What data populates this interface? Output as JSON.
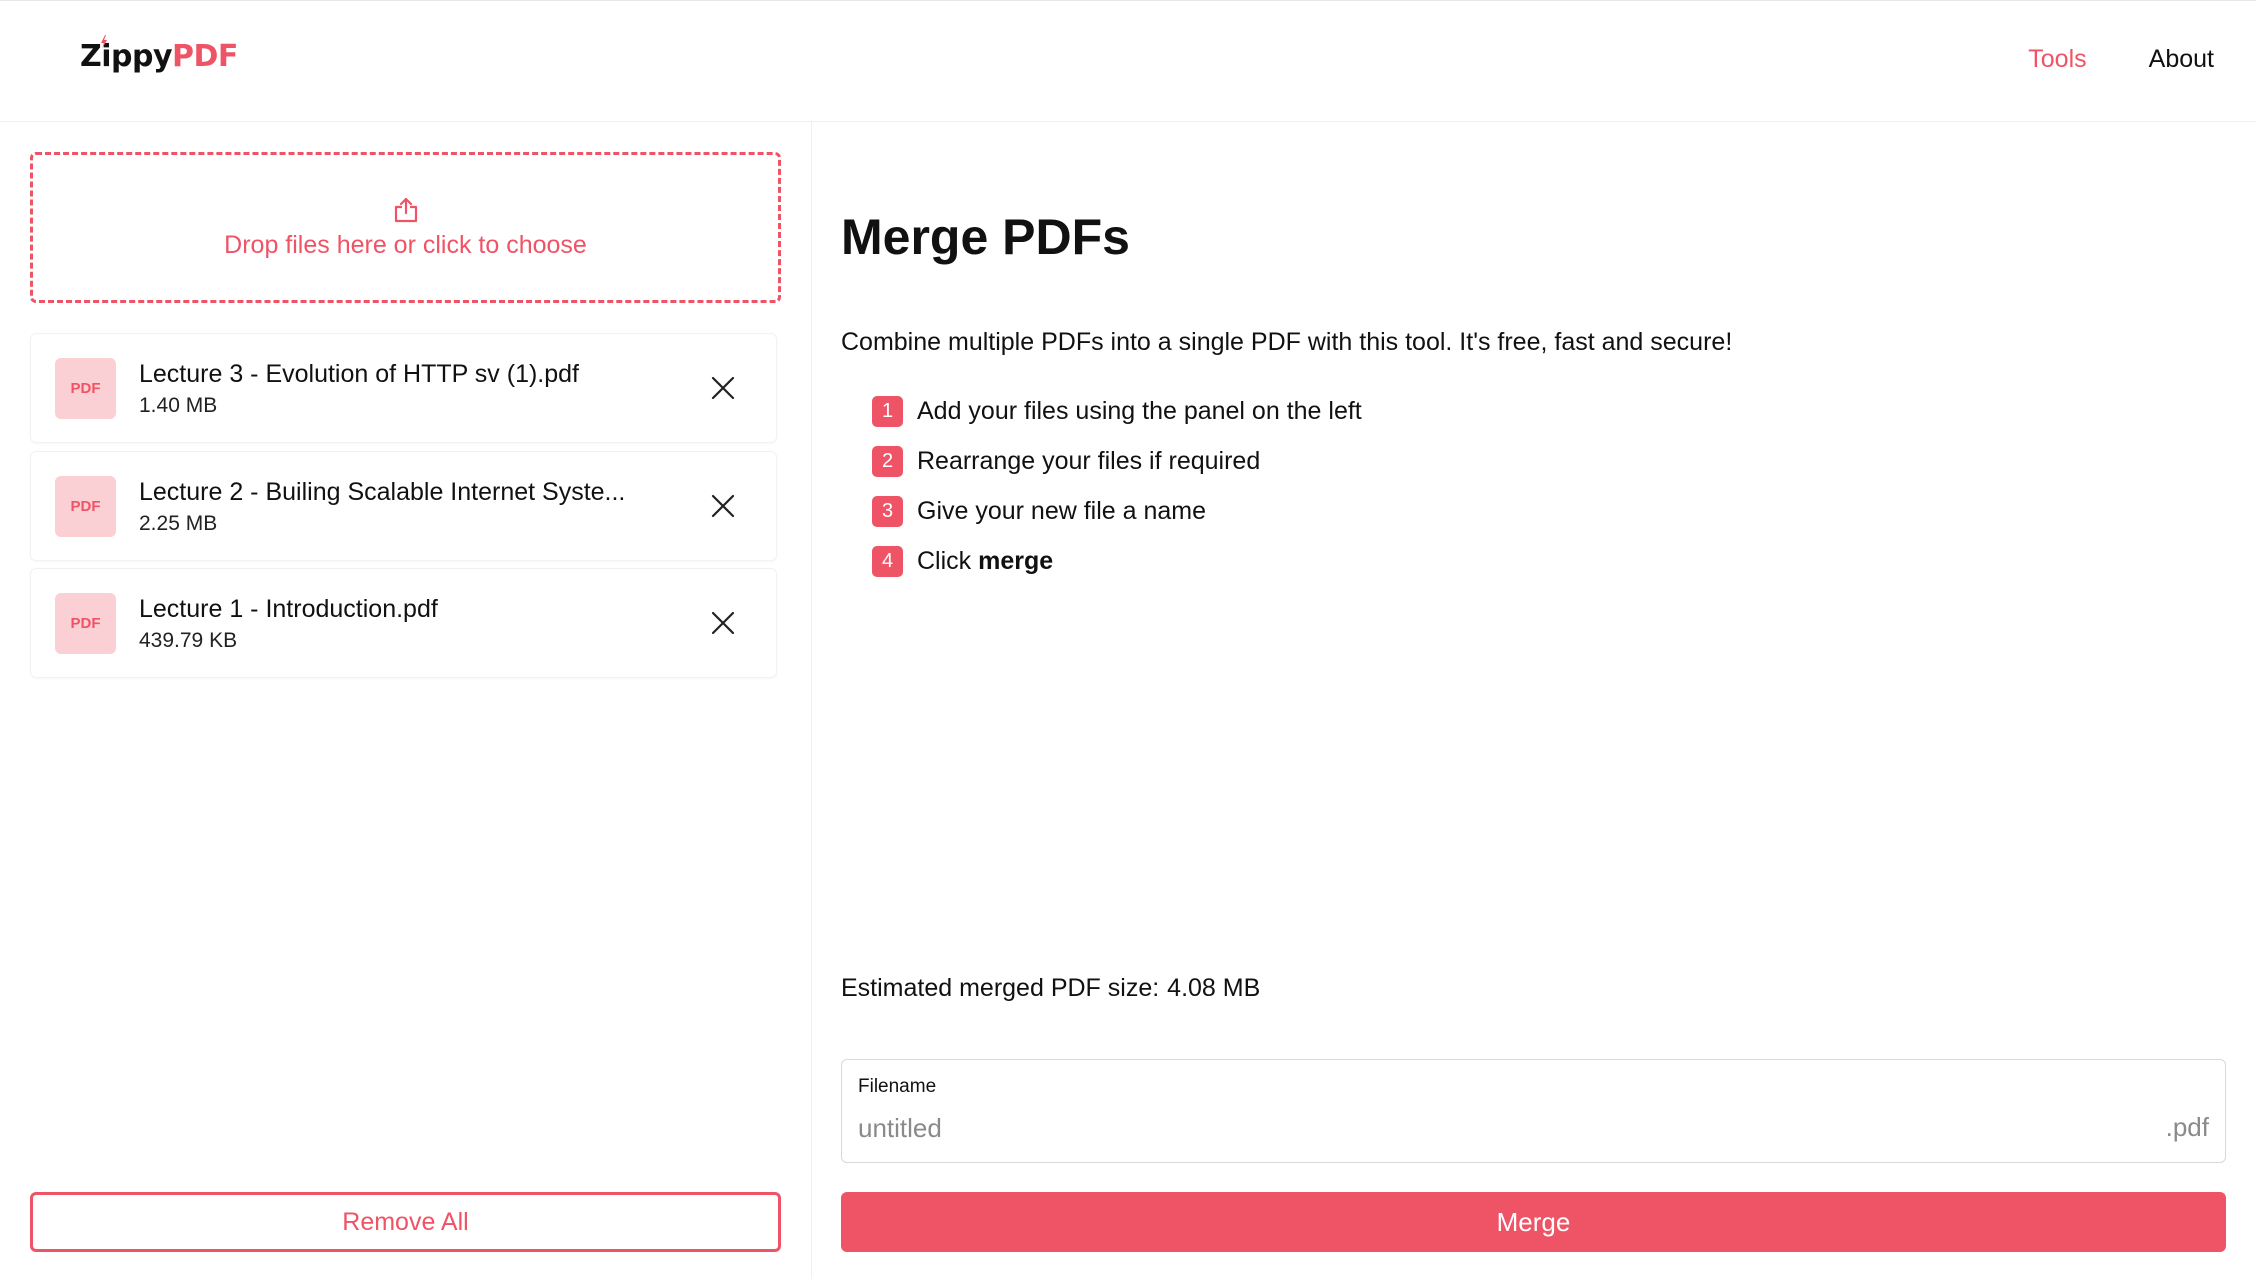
{
  "header": {
    "logo_main": "Zippy",
    "logo_accent": "PDF",
    "nav": [
      {
        "label": "Tools"
      },
      {
        "label": "About"
      }
    ]
  },
  "upload": {
    "icon": "upload-icon",
    "text": "Drop files here or click to choose"
  },
  "files": [
    {
      "badge": "PDF",
      "name": "Lecture 3 - Evolution of HTTP sv (1).pdf",
      "size": "1.40 MB"
    },
    {
      "badge": "PDF",
      "name": "Lecture 2 - Builing Scalable Internet Syste...",
      "size": "2.25 MB"
    },
    {
      "badge": "PDF",
      "name": "Lecture 1 - Introduction.pdf",
      "size": "439.79 KB"
    }
  ],
  "remove_all_label": "Remove All",
  "main": {
    "title": "Merge PDFs",
    "description": "Combine multiple PDFs into a single PDF with this tool. It's free, fast and secure!",
    "steps": [
      {
        "num": "1",
        "text": "Add your files using the panel on the left"
      },
      {
        "num": "2",
        "text": "Rearrange your files if required"
      },
      {
        "num": "3",
        "text": "Give your new file a name"
      },
      {
        "num": "4",
        "text": "Click",
        "bold": "merge"
      }
    ],
    "estimate_label": "Estimated merged PDF size:",
    "estimate_value": "4.08 MB",
    "filename_label": "Filename",
    "filename_placeholder": "untitled",
    "filename_value": "",
    "filename_ext": ".pdf",
    "merge_label": "Merge"
  },
  "colors": {
    "accent": "#ef5366",
    "badge_bg": "#fbd0d5"
  }
}
